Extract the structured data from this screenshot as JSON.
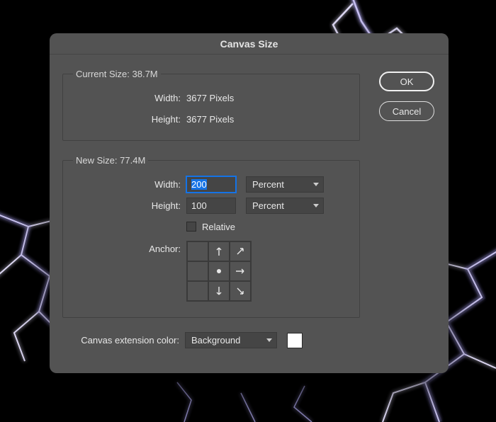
{
  "dialog": {
    "title": "Canvas Size",
    "buttons": {
      "ok": "OK",
      "cancel": "Cancel"
    }
  },
  "current": {
    "legend_label": "Current Size:",
    "legend_value": "38.7M",
    "width_label": "Width:",
    "width_value": "3677 Pixels",
    "height_label": "Height:",
    "height_value": "3677 Pixels"
  },
  "newsize": {
    "legend_label": "New Size:",
    "legend_value": "77.4M",
    "width_label": "Width:",
    "width_value": "200",
    "width_unit": "Percent",
    "height_label": "Height:",
    "height_value": "100",
    "height_unit": "Percent",
    "relative_label": "Relative",
    "relative_checked": false,
    "anchor_label": "Anchor:"
  },
  "extension": {
    "label": "Canvas extension color:",
    "value": "Background",
    "swatch_color": "#ffffff"
  }
}
